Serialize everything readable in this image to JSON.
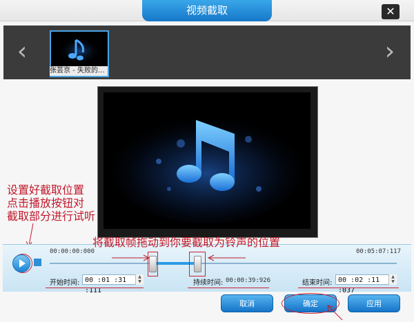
{
  "window": {
    "title": "视频截取"
  },
  "close_glyph": "✕",
  "thumbnail": {
    "label": "张芸京 - 失败的..."
  },
  "nav": {
    "prev": "‹",
    "next": "›"
  },
  "annotations": {
    "left_note": [
      "设置好截取位置",
      "点击播放按钮对",
      "截取部分进行试听"
    ],
    "top_note": "将截取帧拖动到你要截取为铃声的位置"
  },
  "timeline": {
    "start_time": "00:00:00:000",
    "end_time": "00:05:07:117",
    "selection_start_fraction": 0.296,
    "selection_end_fraction": 0.425
  },
  "fields": {
    "start_label": "开始时间:",
    "start_value": "00 :01 :31 :111",
    "duration_label": "持续时间:",
    "duration_value": "00:00:39:926",
    "end_label": "结束时间:",
    "end_value": "00 :02 :11 :037"
  },
  "buttons": {
    "cancel": "取消",
    "ok": "确定",
    "apply": "应用"
  },
  "colors": {
    "accent": "#1a85d6",
    "annotation": "#c0182a"
  }
}
